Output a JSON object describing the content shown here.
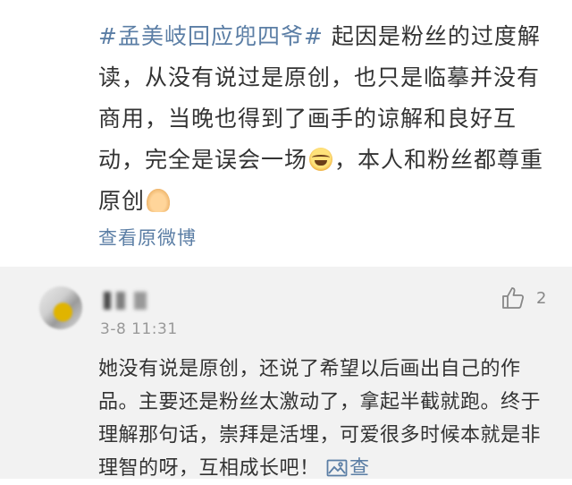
{
  "post": {
    "hashtag": "#孟美岐回应兜四爷#",
    "body_part1": " 起因是粉丝的过度解读，从没有说过是原创，也只是临摹并没有商用，当晚也得到了画手的谅解和良好互动，完全是误会一场",
    "emoji_1": "laughing-crying-emoji",
    "body_part2": "，本人和粉丝都尊重原创",
    "emoji_2": "praying-hands-emoji",
    "view_original_label": "查看原微博"
  },
  "comment": {
    "timestamp": "3-8 11:31",
    "like_count": "2",
    "text": "她没有说是原创，还说了希望以后画出自己的作品。主要还是粉丝太激动了，拿起半截就跑。终于理解那句话，崇拜是活埋，可爱很多时候本就是非理智的呀，互相成长吧！",
    "view_image_label": "查"
  },
  "colors": {
    "link": "#5b7ea5",
    "text": "#333333",
    "comment_bg": "#f2f2f2",
    "muted": "#999999"
  }
}
